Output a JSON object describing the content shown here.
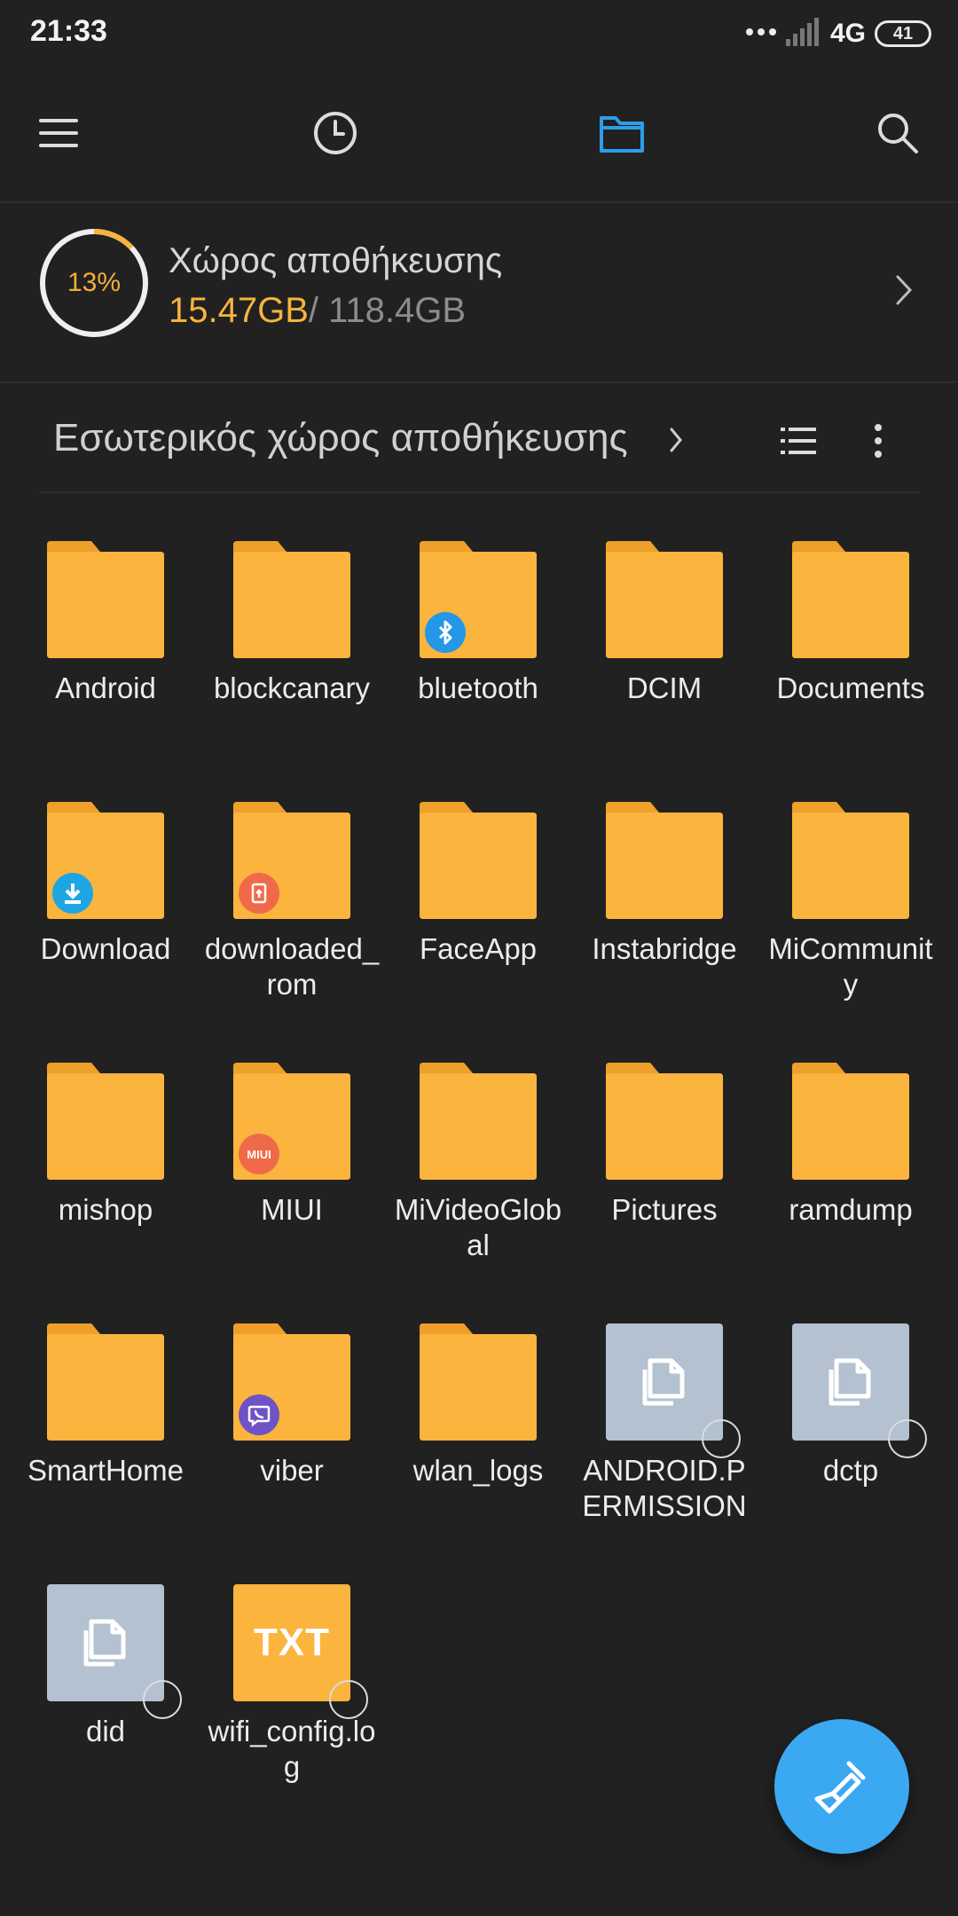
{
  "status_bar": {
    "time": "21:33",
    "network": "4G",
    "battery": "41"
  },
  "storage": {
    "percent": "13%",
    "title": "Χώρος αποθήκευσης",
    "used": "15.47GB",
    "total": "/ 118.4GB",
    "used_fraction": 0.13
  },
  "path": {
    "label": "Εσωτερικός χώρος αποθήκευσης"
  },
  "items": [
    {
      "name": "Android",
      "type": "folder"
    },
    {
      "name": "blockcanary",
      "type": "folder"
    },
    {
      "name": "bluetooth",
      "type": "folder",
      "badge": "bluetooth-icon"
    },
    {
      "name": "DCIM",
      "type": "folder"
    },
    {
      "name": "Documents",
      "type": "folder"
    },
    {
      "name": "Download",
      "type": "folder",
      "badge": "download-icon"
    },
    {
      "name": "downloaded_rom",
      "type": "folder",
      "badge": "rom-icon"
    },
    {
      "name": "FaceApp",
      "type": "folder"
    },
    {
      "name": "Instabridge",
      "type": "folder"
    },
    {
      "name": "MiCommunity",
      "type": "folder"
    },
    {
      "name": "mishop",
      "type": "folder"
    },
    {
      "name": "MIUI",
      "type": "folder",
      "badge": "miui-icon",
      "badge_text": "MIUI"
    },
    {
      "name": "MiVideoGlobal",
      "type": "folder"
    },
    {
      "name": "Pictures",
      "type": "folder"
    },
    {
      "name": "ramdump",
      "type": "folder"
    },
    {
      "name": "SmartHome",
      "type": "folder"
    },
    {
      "name": "viber",
      "type": "folder",
      "badge": "viber-icon"
    },
    {
      "name": "wlan_logs",
      "type": "folder"
    },
    {
      "name": "ANDROID.PERMISSION",
      "type": "file"
    },
    {
      "name": "dctp",
      "type": "file"
    },
    {
      "name": "did",
      "type": "file"
    },
    {
      "name": "wifi_config.log",
      "type": "txt",
      "thumb_text": "TXT"
    }
  ],
  "colors": {
    "background": "#212121",
    "folder": "#fbb43d",
    "folder_tab": "#eea02a",
    "accent": "#3ba9f2",
    "storage_used": "#f6b43e"
  }
}
